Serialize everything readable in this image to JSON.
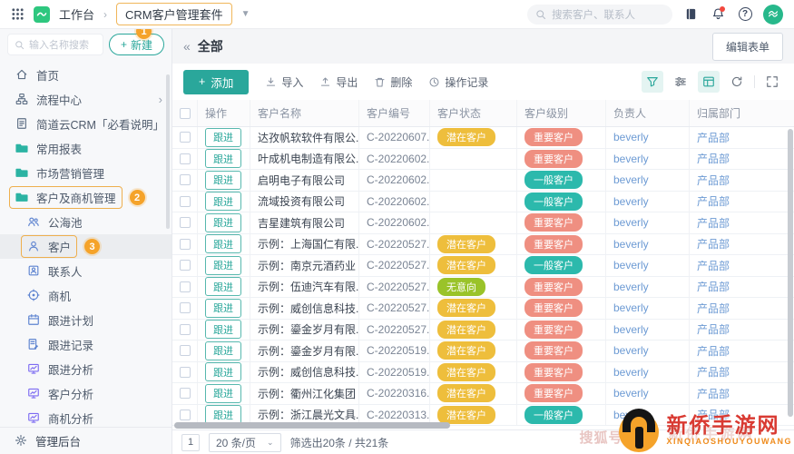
{
  "topbar": {
    "workbench_label": "工作台",
    "app_title": "CRM客户管理套件",
    "search_placeholder": "搜索客户、联系人"
  },
  "sidebar": {
    "search_placeholder": "输入名称搜索",
    "new_button_label": "新建",
    "items": [
      {
        "label": "首页",
        "icon": "home"
      },
      {
        "label": "流程中心",
        "icon": "flow",
        "chevron": true
      },
      {
        "label": "简道云CRM「必看说明」",
        "icon": "doc"
      },
      {
        "label": "常用报表",
        "icon": "folder"
      },
      {
        "label": "市场营销管理",
        "icon": "folder"
      },
      {
        "label": "客户及商机管理",
        "icon": "folder",
        "boxed": true,
        "badge": "2"
      },
      {
        "label": "公海池",
        "icon": "users",
        "indent": true
      },
      {
        "label": "客户",
        "icon": "user",
        "indent": true,
        "boxed": true,
        "selected": true,
        "badge": "3"
      },
      {
        "label": "联系人",
        "icon": "contact",
        "indent": true
      },
      {
        "label": "商机",
        "icon": "target",
        "indent": true
      },
      {
        "label": "跟进计划",
        "icon": "calendar",
        "indent": true
      },
      {
        "label": "跟进记录",
        "icon": "record",
        "indent": true
      },
      {
        "label": "跟进分析",
        "icon": "chart",
        "indent": true
      },
      {
        "label": "客户分析",
        "icon": "chart",
        "indent": true
      },
      {
        "label": "商机分析",
        "icon": "chart",
        "indent": true
      }
    ],
    "footer_label": "管理后台"
  },
  "page": {
    "view_title": "全部",
    "edit_form_label": "编辑表单"
  },
  "toolbar": {
    "add_label": "添加",
    "import_label": "导入",
    "export_label": "导出",
    "delete_label": "删除",
    "log_label": "操作记录"
  },
  "table": {
    "columns": [
      "操作",
      "客户名称",
      "客户编号",
      "客户状态",
      "客户级别",
      "负责人",
      "归属部门"
    ],
    "action_label": "跟进",
    "rows": [
      {
        "name": "达孜帆软软件有限公...",
        "number": "C-20220607...",
        "status": "潜在客户",
        "level": "重要客户",
        "owner": "beverly",
        "dept": "产品部"
      },
      {
        "name": "叶成机电制造有限公...",
        "number": "C-20220602...",
        "status": "",
        "level": "重要客户",
        "owner": "beverly",
        "dept": "产品部"
      },
      {
        "name": "启明电子有限公司",
        "number": "C-20220602...",
        "status": "",
        "level": "一般客户",
        "owner": "beverly",
        "dept": "产品部"
      },
      {
        "name": "流域投资有限公司",
        "number": "C-20220602...",
        "status": "",
        "level": "一般客户",
        "owner": "beverly",
        "dept": "产品部"
      },
      {
        "name": "吉星建筑有限公司",
        "number": "C-20220602...",
        "status": "",
        "level": "重要客户",
        "owner": "beverly",
        "dept": "产品部"
      },
      {
        "name": "示例：上海国仁有限...",
        "number": "C-20220527...",
        "status": "潜在客户",
        "level": "重要客户",
        "owner": "beverly",
        "dept": "产品部"
      },
      {
        "name": "示例：南京元酒药业",
        "number": "C-20220527...",
        "status": "潜在客户",
        "level": "一般客户",
        "owner": "beverly",
        "dept": "产品部"
      },
      {
        "name": "示例：伍迪汽车有限...",
        "number": "C-20220527...",
        "status": "无意向",
        "level": "重要客户",
        "owner": "beverly",
        "dept": "产品部"
      },
      {
        "name": "示例：威创信息科技...",
        "number": "C-20220527...",
        "status": "潜在客户",
        "level": "重要客户",
        "owner": "beverly",
        "dept": "产品部"
      },
      {
        "name": "示例：鎏金岁月有限...",
        "number": "C-20220527...",
        "status": "潜在客户",
        "level": "重要客户",
        "owner": "beverly",
        "dept": "产品部"
      },
      {
        "name": "示例：鎏金岁月有限...",
        "number": "C-20220519...",
        "status": "潜在客户",
        "level": "重要客户",
        "owner": "beverly",
        "dept": "产品部"
      },
      {
        "name": "示例：威创信息科技...",
        "number": "C-20220519...",
        "status": "潜在客户",
        "level": "重要客户",
        "owner": "beverly",
        "dept": "产品部"
      },
      {
        "name": "示例：衢州江化集团",
        "number": "C-20220316...",
        "status": "潜在客户",
        "level": "重要客户",
        "owner": "beverly",
        "dept": "产品部"
      },
      {
        "name": "示例：浙江晨光文具...",
        "number": "C-20220313...",
        "status": "潜在客户",
        "level": "一般客户",
        "owner": "beverly",
        "dept": "产品部"
      }
    ]
  },
  "badge_colors": {
    "潜在客户": "#eebe3c",
    "无意向": "#9ac329",
    "重要客户": "#ef8f81",
    "一般客户": "#2cb9ac"
  },
  "pagination": {
    "page": "1",
    "page_size": "20 条/页",
    "summary": "筛选出20条 / 共21条"
  },
  "annotations": [
    "1",
    "2",
    "3"
  ],
  "watermark": {
    "title": "新侨手游网",
    "subtitle": "XINQIAOSHOUYOUWANG",
    "ghost_left": "搜狐号",
    "ghost_right": "新侨手游网"
  },
  "colors": {
    "accent_teal": "#2aa79b",
    "annotation_orange": "#f5a32a",
    "highlight_border": "#eeaf4e",
    "link_blue": "#6d9bd4"
  }
}
